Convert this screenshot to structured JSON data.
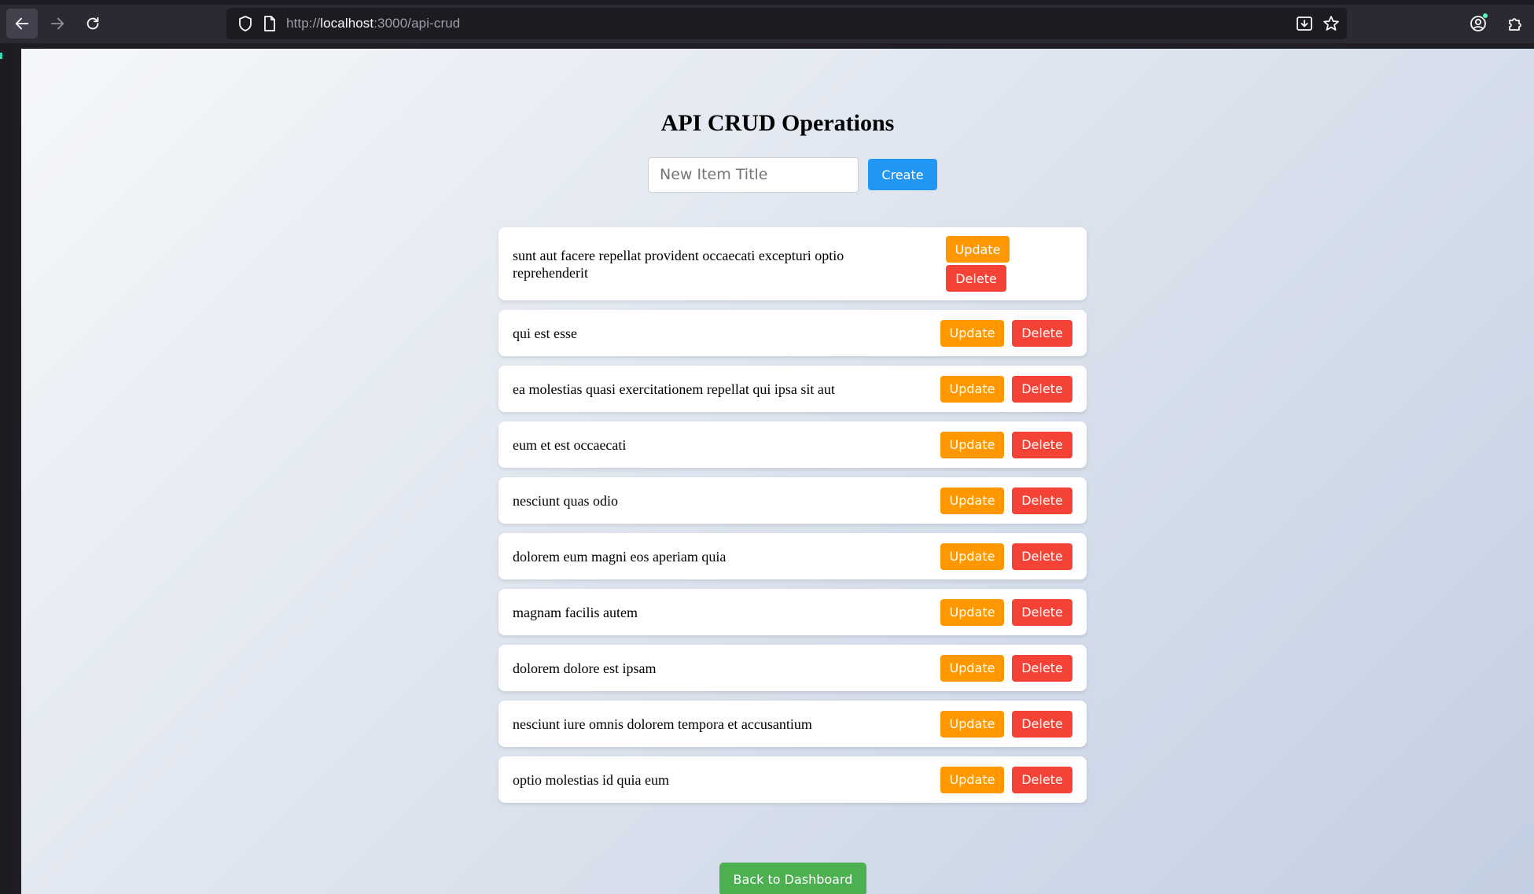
{
  "browser": {
    "url_scheme": "http://",
    "url_host": "localhost",
    "url_rest": ":3000/api-crud"
  },
  "page": {
    "title": "API CRUD Operations",
    "input_placeholder": "New Item Title",
    "create_label": "Create",
    "back_label": "Back to Dashboard",
    "update_label": "Update",
    "delete_label": "Delete"
  },
  "items": [
    {
      "title": "sunt aut facere repellat provident occaecati excepturi optio reprehenderit"
    },
    {
      "title": "qui est esse"
    },
    {
      "title": "ea molestias quasi exercitationem repellat qui ipsa sit aut"
    },
    {
      "title": "eum et est occaecati"
    },
    {
      "title": "nesciunt quas odio"
    },
    {
      "title": "dolorem eum magni eos aperiam quia"
    },
    {
      "title": "magnam facilis autem"
    },
    {
      "title": "dolorem dolore est ipsam"
    },
    {
      "title": "nesciunt iure omnis dolorem tempora et accusantium"
    },
    {
      "title": "optio molestias id quia eum"
    }
  ],
  "colors": {
    "create": "#2196f3",
    "update": "#ff9800",
    "delete": "#f44336",
    "back": "#4caf50"
  }
}
